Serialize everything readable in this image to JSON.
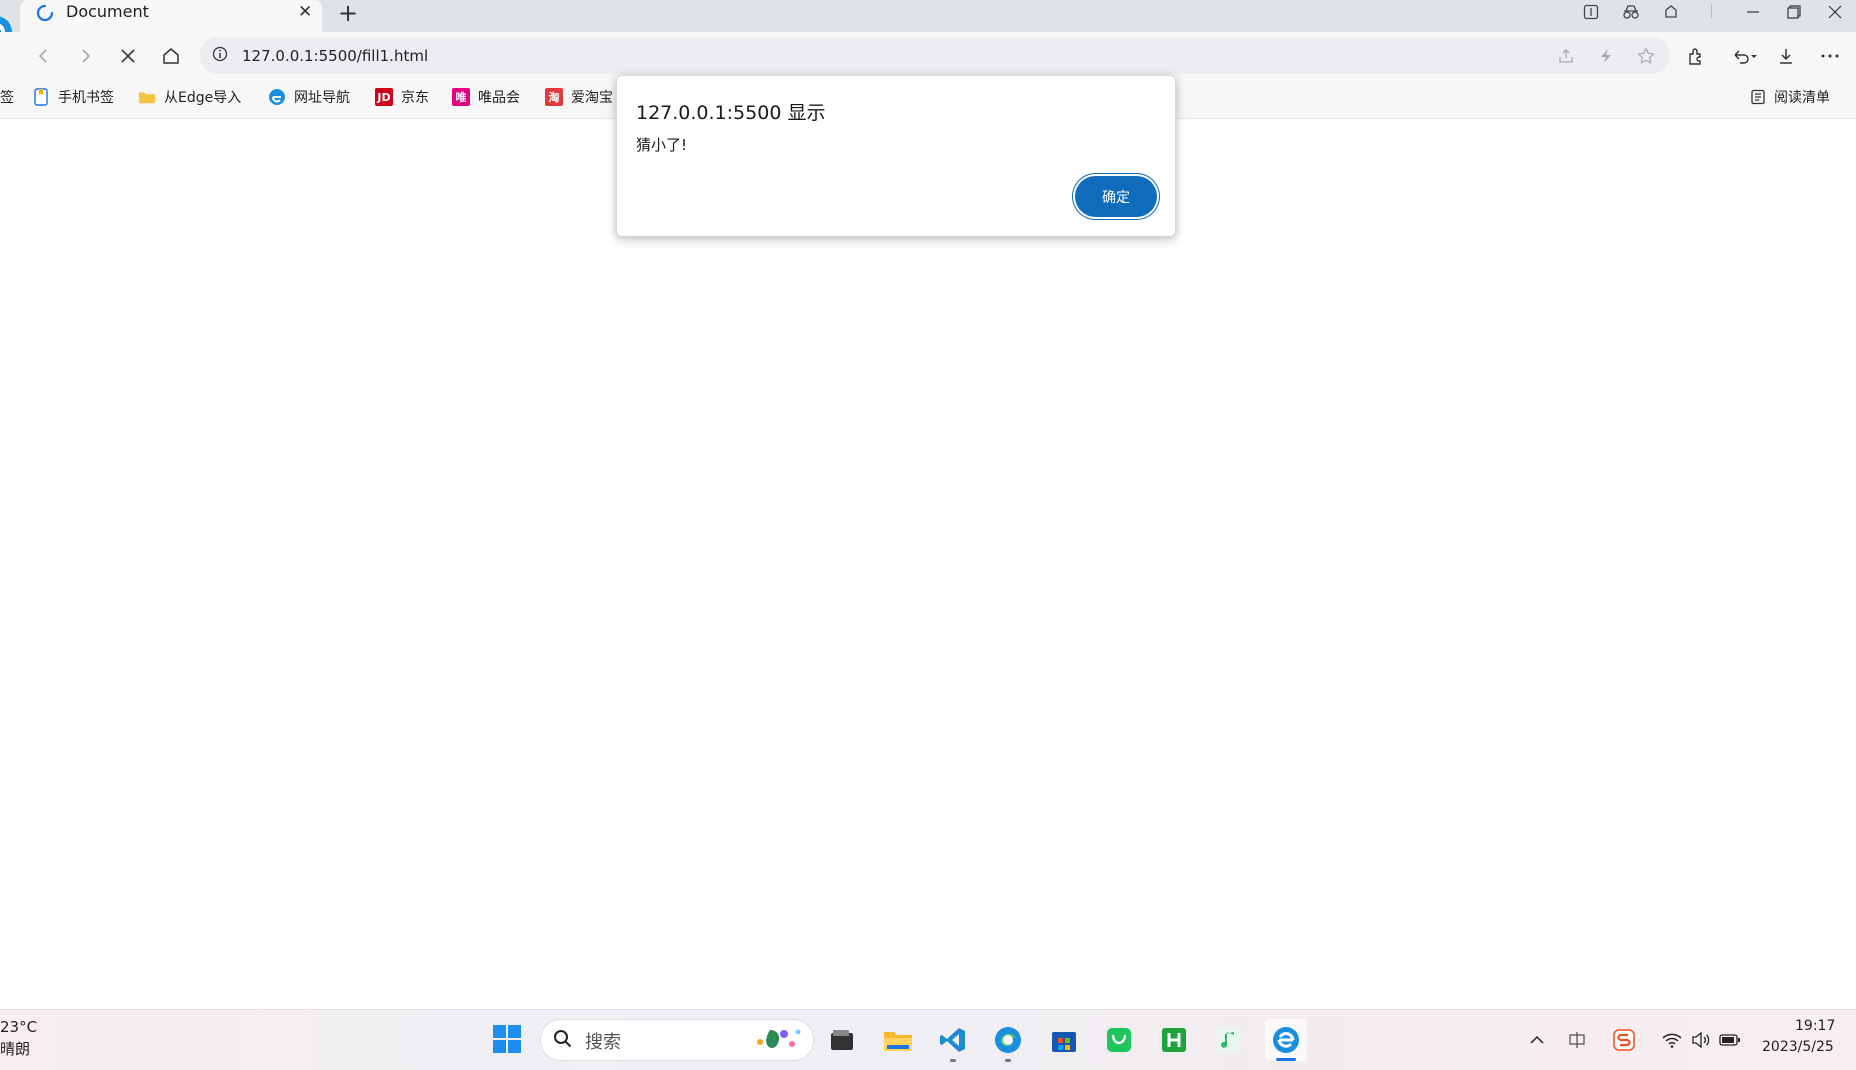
{
  "tab": {
    "title": "Document",
    "close_glyph": "✕",
    "new_tab_glyph": "+"
  },
  "toolbar": {
    "url": "127.0.0.1:5500/fill1.html"
  },
  "bookmarks": [
    {
      "label": "签",
      "icon": "none"
    },
    {
      "label": "手机书签",
      "icon": "phone-bookmark-icon"
    },
    {
      "label": "从Edge导入",
      "icon": "folder-icon"
    },
    {
      "label": "网址导航",
      "icon": "browser-e-icon"
    },
    {
      "label": "京东",
      "icon": "jd-icon",
      "icon_text": "JD",
      "color": "#d0021b"
    },
    {
      "label": "唯品会",
      "icon": "vip-icon",
      "icon_text": "唯",
      "color": "#e4007f"
    },
    {
      "label": "爱淘宝",
      "icon": "taobao-icon",
      "icon_text": "淘",
      "color": "#e4393c"
    }
  ],
  "reading_list": {
    "label": "阅读清单"
  },
  "dialog": {
    "title": "127.0.0.1:5500 显示",
    "message": "猜小了!",
    "ok_label": "确定",
    "accent": "#0f6cbd"
  },
  "taskbar": {
    "weather_temp": "23°C",
    "weather_desc": "晴朗",
    "search_label": "搜索",
    "time": "19:17",
    "date": "2023/5/25",
    "apps": [
      "file-manager-icon",
      "folder-icon",
      "vscode-icon",
      "edge-icon",
      "store-icon",
      "wechat-icon",
      "hbuilder-icon",
      "music-icon",
      "browser-e-icon"
    ]
  },
  "colors": {
    "tabstrip": "#dfe3e8",
    "toolbar": "#f7f7f7",
    "accent": "#0f6cbd"
  }
}
